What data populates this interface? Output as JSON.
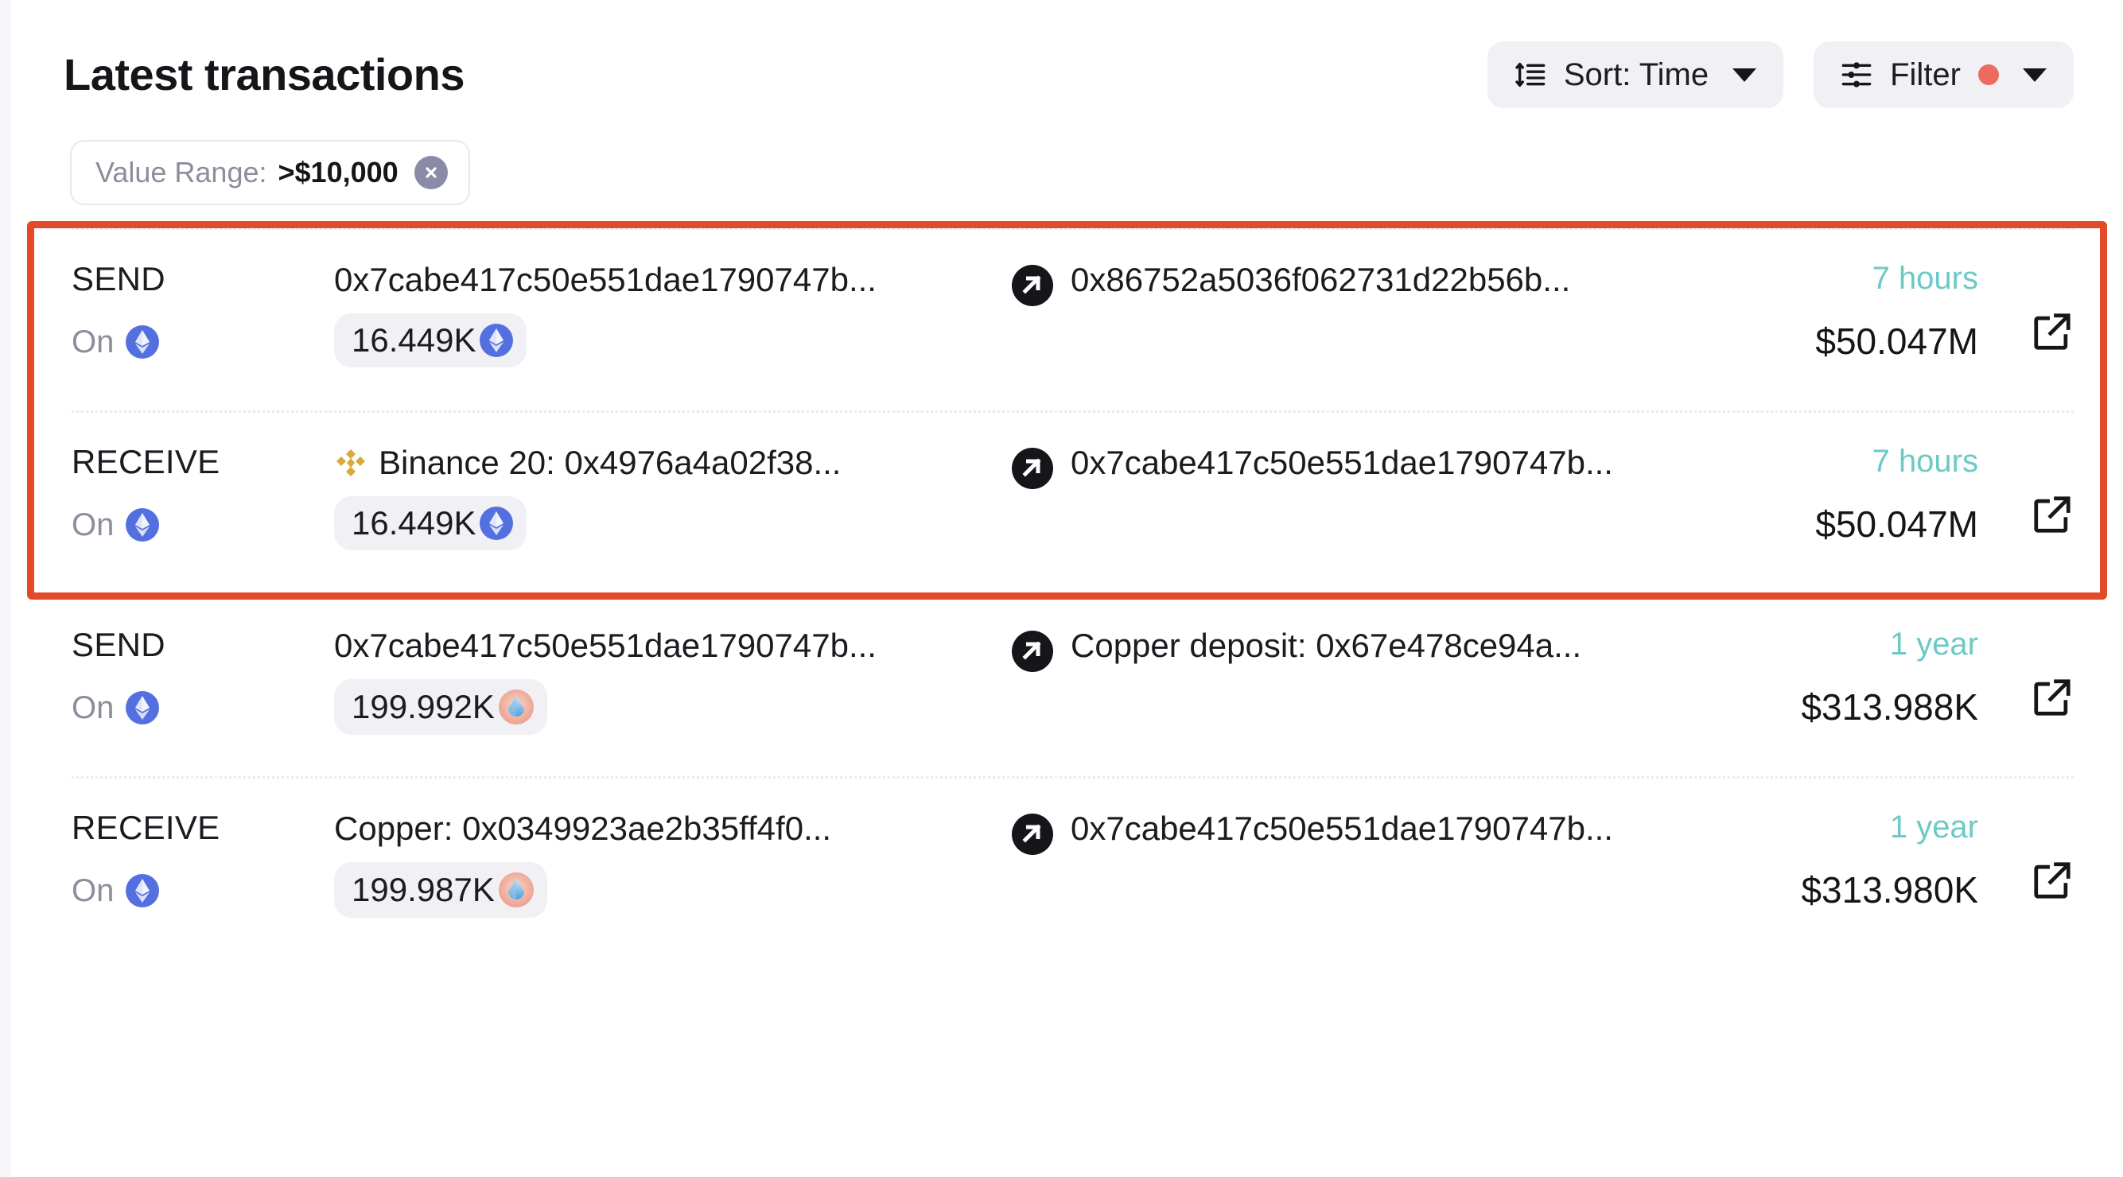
{
  "header": {
    "title": "Latest transactions",
    "sort_button": {
      "label": "Sort: Time",
      "icon": "sort-icon"
    },
    "filter_button": {
      "label": "Filter",
      "icon": "filter-sliders-icon",
      "badge_color": "#ec6a5e"
    }
  },
  "filters": {
    "chips": [
      {
        "key": "Value Range:",
        "value": ">$10,000",
        "remove_icon": "close-circle-icon"
      }
    ]
  },
  "highlight": {
    "color": "#e24a2a",
    "rows": [
      0,
      1
    ]
  },
  "colors": {
    "accent_red": "#e24a2a",
    "time_teal": "#6dc9c6",
    "muted": "#8d8d9c",
    "pill_bg": "#f1f1f5",
    "eth_blue": "#5470e0",
    "binance_gold": "#d9a93a"
  },
  "transactions": [
    {
      "direction": "SEND",
      "chain_label": "On",
      "chain_icon": "ethereum-icon",
      "from": "0x7cabe417c50e551dae1790747b...",
      "from_icon": null,
      "amount": "16.449K",
      "amount_icon": "ethereum-icon",
      "arrow_icon": "arrow-up-right-circle-icon",
      "to": "0x86752a5036f062731d22b56b...",
      "time": "7 hours",
      "usd_value": "$50.047M",
      "link_icon": "external-link-icon"
    },
    {
      "direction": "RECEIVE",
      "chain_label": "On",
      "chain_icon": "ethereum-icon",
      "from": "Binance 20: 0x4976a4a02f38...",
      "from_icon": "binance-icon",
      "amount": "16.449K",
      "amount_icon": "ethereum-icon",
      "arrow_icon": "arrow-up-right-circle-icon",
      "to": "0x7cabe417c50e551dae1790747b...",
      "time": "7 hours",
      "usd_value": "$50.047M",
      "link_icon": "external-link-icon"
    },
    {
      "direction": "SEND",
      "chain_label": "On",
      "chain_icon": "ethereum-icon",
      "from": "0x7cabe417c50e551dae1790747b...",
      "from_icon": null,
      "amount": "199.992K",
      "amount_icon": "steth-token-icon",
      "arrow_icon": "arrow-up-right-circle-icon",
      "to": "Copper deposit: 0x67e478ce94a...",
      "time": "1 year",
      "usd_value": "$313.988K",
      "link_icon": "external-link-icon"
    },
    {
      "direction": "RECEIVE",
      "chain_label": "On",
      "chain_icon": "ethereum-icon",
      "from": "Copper: 0x0349923ae2b35ff4f0...",
      "from_icon": null,
      "amount": "199.987K",
      "amount_icon": "steth-token-icon",
      "arrow_icon": "arrow-up-right-circle-icon",
      "to": "0x7cabe417c50e551dae1790747b...",
      "time": "1 year",
      "usd_value": "$313.980K",
      "link_icon": "external-link-icon"
    }
  ]
}
